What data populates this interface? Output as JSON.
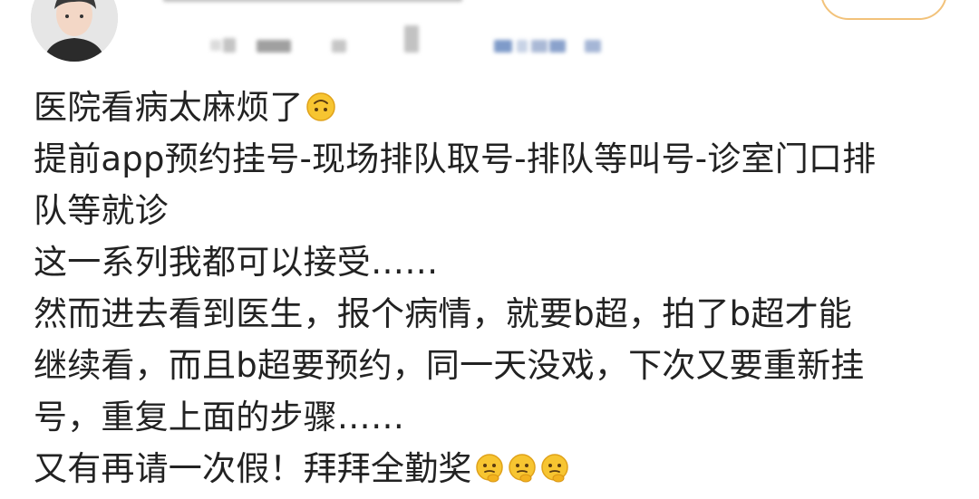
{
  "post": {
    "author": {
      "avatar_icon": "user-avatar"
    },
    "follow_button_icon": "follow-button",
    "lines": [
      "医院看病太麻烦了",
      "提前app预约挂号-现场排队取号-排队等叫号-诊室门口排",
      "队等就诊",
      "这一系列我都可以接受……",
      "然而进去看到医生，报个病情，就要b超，拍了b超才能",
      "继续看，而且b超要预约，同一天没戏，下次又要重新挂",
      "号，重复上面的步骤……",
      "又有再请一次假！拜拜全勤奖"
    ],
    "emojis": {
      "line1": "upside-down-face-emoji",
      "line8": [
        "thinking-face-emoji",
        "thinking-face-emoji",
        "thinking-face-emoji"
      ]
    }
  },
  "colors": {
    "text": "#222222",
    "follow_border": "#f2c27a",
    "blur_gray": "#c8c8c8",
    "blur_blue": "#7f9bc9",
    "emoji_yellow": "#f7c531"
  }
}
